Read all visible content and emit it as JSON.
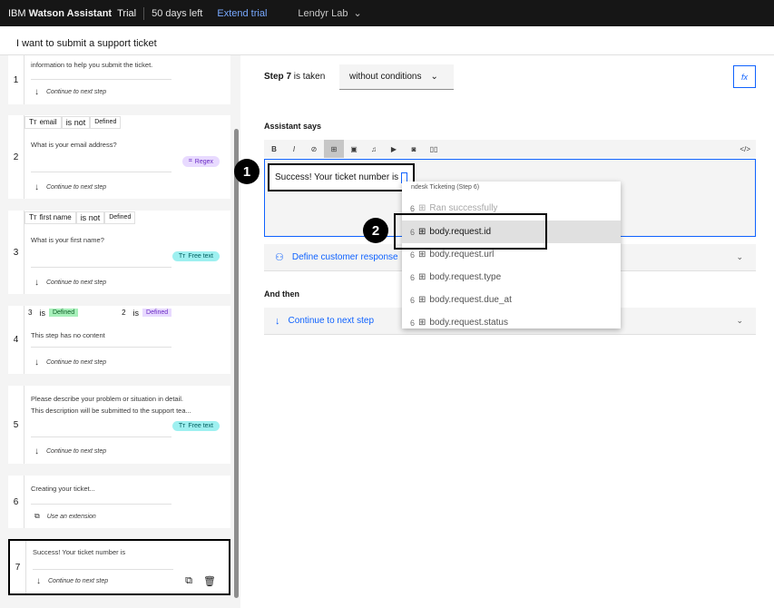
{
  "topbar": {
    "brand_prefix": "IBM",
    "brand_name": "Watson Assistant",
    "plan": "Trial",
    "days_left": "50 days left",
    "extend": "Extend trial",
    "instance": "Lendyr Lab"
  },
  "action": {
    "title": "I want to submit a support ticket"
  },
  "steps": [
    {
      "number": "1",
      "text": "information to help you submit the ticket.",
      "continue": "Continue to next step"
    },
    {
      "number": "2",
      "cond_var": "email",
      "cond_op": "is not",
      "cond_val": "Defined",
      "text": "What is your email address?",
      "tag": "Regex",
      "continue": "Continue to next step"
    },
    {
      "number": "3",
      "cond_var": "first name",
      "cond_op": "is not",
      "cond_val": "Defined",
      "text": "What is your first name?",
      "tag": "Free text",
      "continue": "Continue to next step"
    },
    {
      "number": "4",
      "cond_a_var": "3",
      "cond_a_op": "is",
      "cond_a_val": "Defined",
      "cond_b_var": "2",
      "cond_b_op": "is",
      "cond_b_val": "Defined",
      "text": "This step has no content",
      "continue": "Continue to next step"
    },
    {
      "number": "5",
      "text_line1": "Please describe your problem or situation in detail.",
      "text_line2": "This description will be submitted to the support tea...",
      "tag": "Free text",
      "continue": "Continue to next step"
    },
    {
      "number": "6",
      "text": "Creating your ticket...",
      "continue": "Use an extension"
    },
    {
      "number": "7",
      "text": "Success! Your ticket number is",
      "continue": "Continue to next step"
    }
  ],
  "editor": {
    "step_label": "Step 7",
    "step_suffix": "is taken",
    "condition": "without conditions",
    "fx": "fx",
    "assistant_says": "Assistant says",
    "message": "Success! Your ticket number is",
    "define_response": "Define customer response",
    "and_then": "And then",
    "continue": "Continue to next step"
  },
  "toolbar": {
    "bold": "B",
    "italic": "I",
    "code": "</>"
  },
  "dropdown": {
    "header": "ndesk Ticketing (Step 6)",
    "items": [
      {
        "prefix": "6",
        "label": "Ran successfully"
      },
      {
        "prefix": "6",
        "label": "body.request.id"
      },
      {
        "prefix": "6",
        "label": "body.request.url"
      },
      {
        "prefix": "6",
        "label": "body.request.type"
      },
      {
        "prefix": "6",
        "label": "body.request.due_at"
      },
      {
        "prefix": "6",
        "label": "body.request.status"
      }
    ]
  },
  "callouts": {
    "one": "1",
    "two": "2"
  }
}
